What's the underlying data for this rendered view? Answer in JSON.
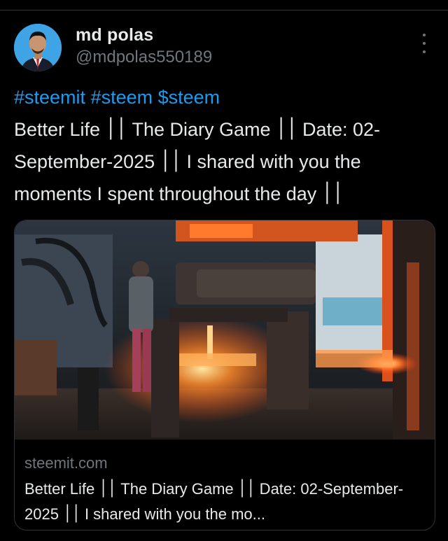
{
  "post": {
    "author_name": "md polas",
    "author_handle": "@mdpolas550189",
    "hashtags": [
      "#steemit",
      "#steem",
      "$steem"
    ],
    "text": "Better Life ׀׀ The Diary Game ׀׀ Date: 02-September-2025 ׀׀ I shared with you the moments I spent throughout the day ׀׀"
  },
  "card": {
    "domain": "steemit.com",
    "title": "Better Life ׀׀ The Diary Game ׀׀ Date: 02-September-2025 ׀׀ I shared with you the mo..."
  },
  "colors": {
    "background": "#000000",
    "link": "#1d9bf0",
    "text": "#e7e9ea",
    "secondary": "#71767b",
    "border": "#2f3336"
  },
  "icons": [
    "more-options-icon"
  ]
}
